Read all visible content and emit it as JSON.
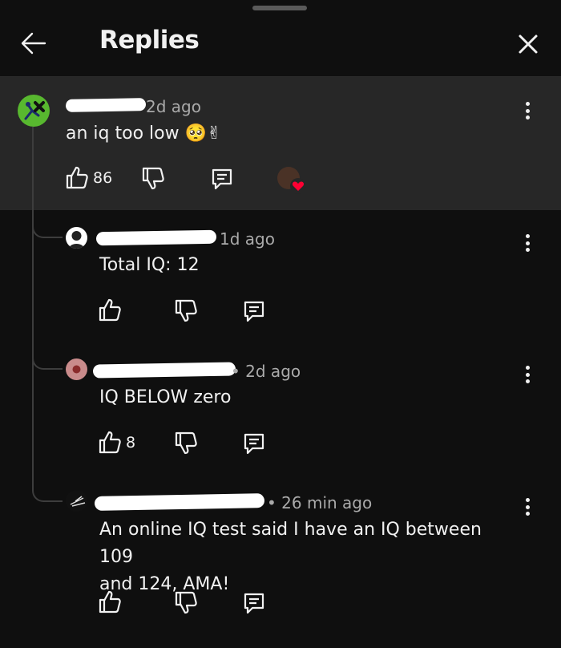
{
  "header": {
    "title": "Replies"
  },
  "comments": [
    {
      "timestamp": "2d ago",
      "text": "an iq too low",
      "emoji": "🥺✌",
      "likes": "86"
    },
    {
      "timestamp": "1d ago",
      "text": "Total IQ: 12",
      "likes": ""
    },
    {
      "timestamp": "• 2d ago",
      "text": "IQ BELOW zero",
      "likes": "8"
    },
    {
      "timestamp": "• 26 min ago",
      "text_line1": "An online IQ test said I have an IQ between 109",
      "text_line2": "and 124, AMA!",
      "likes": ""
    }
  ],
  "icons": {
    "back": "back-arrow-icon",
    "close": "close-icon",
    "like": "thumbs-up-icon",
    "dislike": "thumbs-down-icon",
    "reply": "reply-icon",
    "more": "more-vertical-icon",
    "creator_heart": "creator-heart-icon"
  },
  "colors": {
    "background": "#0f0f0f",
    "highlight": "#272727",
    "heart": "#ff0033",
    "meta": "#aaaaaa"
  }
}
